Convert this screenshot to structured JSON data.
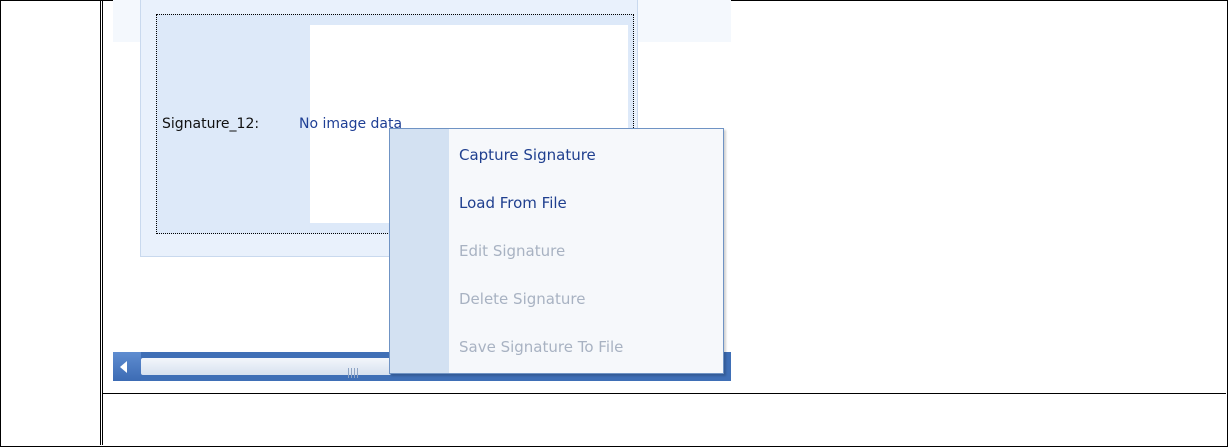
{
  "signature_field": {
    "label": "Signature_12:",
    "value": "No image data"
  },
  "context_menu": {
    "items": [
      {
        "label": "Capture Signature",
        "enabled": true
      },
      {
        "label": "Load From File",
        "enabled": true
      },
      {
        "label": "Edit Signature",
        "enabled": false
      },
      {
        "label": "Delete Signature",
        "enabled": false
      },
      {
        "label": "Save Signature To File",
        "enabled": false
      }
    ]
  },
  "icons": {
    "scroll_left": "scroll-left-arrow-icon",
    "scroll_grip": "scrollbar-grip-icon"
  },
  "colors": {
    "menu_enabled_text": "#1f3f8f",
    "menu_disabled_text": "#a8b2c2",
    "scrollbar": "#3f6fb6"
  }
}
